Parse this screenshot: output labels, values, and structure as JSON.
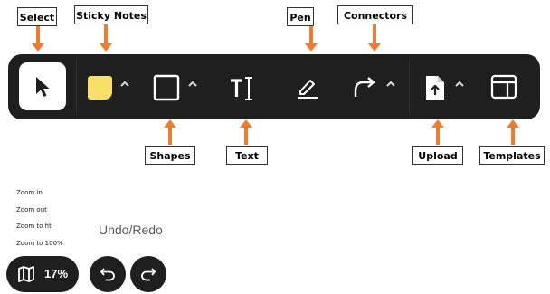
{
  "colors": {
    "accent": "#ed7d31",
    "toolbar_bg": "#1f1f1f",
    "sticky": "#f8df6a"
  },
  "callouts": {
    "select": "Select",
    "sticky_notes": "Sticky Notes",
    "pen": "Pen",
    "connectors": "Connectors",
    "shapes": "Shapes",
    "text": "Text",
    "upload": "Upload",
    "templates": "Templates"
  },
  "toolbar": {
    "icons": [
      "cursor-arrow-icon",
      "sticky-note-icon",
      "square-icon",
      "text-cursor-icon",
      "pen-icon",
      "connector-icon",
      "upload-file-icon",
      "templates-layout-icon"
    ]
  },
  "zoom_menu": {
    "items": [
      "Zoom in",
      "Zoom out",
      "Zoom to fit",
      "Zoom to 100%"
    ]
  },
  "undo_redo_label": "Undo/Redo",
  "zoom_control": {
    "percent": "17%"
  }
}
